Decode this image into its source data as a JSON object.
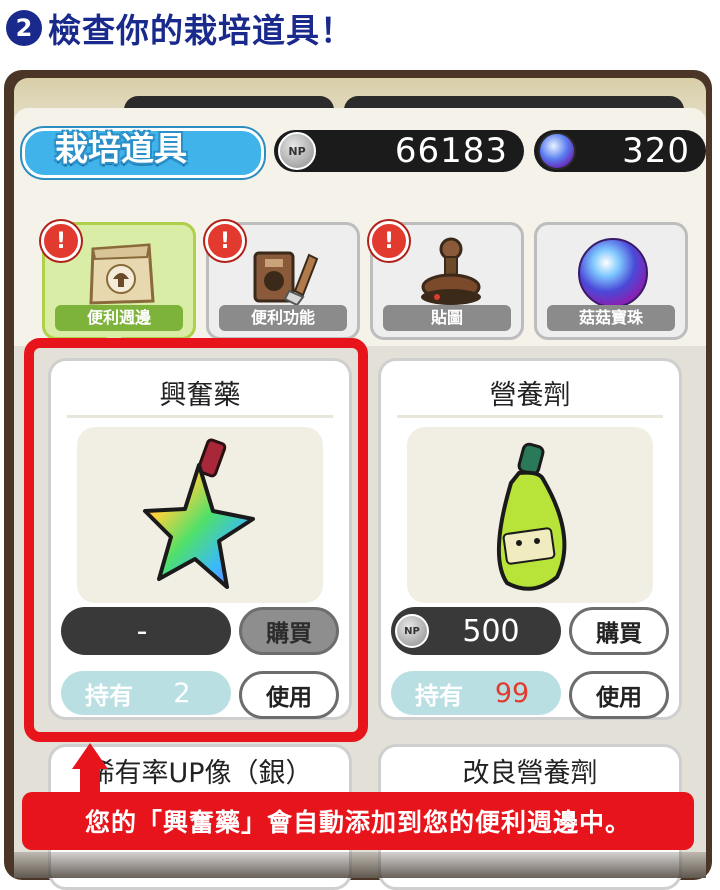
{
  "header": {
    "step_number": "2",
    "title": "檢查你的栽培道具！"
  },
  "screen": {
    "title": "栽培道具",
    "currency": [
      {
        "icon": "np-coin-icon",
        "badge": "NP",
        "value": "66183"
      },
      {
        "icon": "gem-orb-icon",
        "value": "320"
      }
    ],
    "tabs": [
      {
        "label": "便利週邊",
        "icon": "bag-icon",
        "alert": "!",
        "active": true
      },
      {
        "label": "便利功能",
        "icon": "tools-icon",
        "alert": "!",
        "active": false
      },
      {
        "label": "貼圖",
        "icon": "stamp-icon",
        "alert": "!",
        "active": false
      },
      {
        "label": "菇菇寶珠",
        "icon": "orb-icon",
        "active": false
      }
    ],
    "items": [
      {
        "name": "興奮藥",
        "icon": "rainbow-star-potion-icon",
        "price": "-",
        "buy": "購買",
        "owned_label": "持有",
        "owned": "2",
        "use": "使用"
      },
      {
        "name": "營養劑",
        "icon": "green-bottle-icon",
        "currency_badge": "NP",
        "price": "500",
        "buy": "購買",
        "owned_label": "持有",
        "owned": "99",
        "use": "使用"
      }
    ],
    "next_items": [
      "稀有率UP像（銀）",
      "改良營養劑"
    ]
  },
  "callout": "您的「興奮藥」會自動添加到您的便利週邊中。",
  "colors": {
    "accent_red": "#e8141c",
    "title_blue": "#1a2a8c",
    "tab_green": "#7db33a"
  }
}
